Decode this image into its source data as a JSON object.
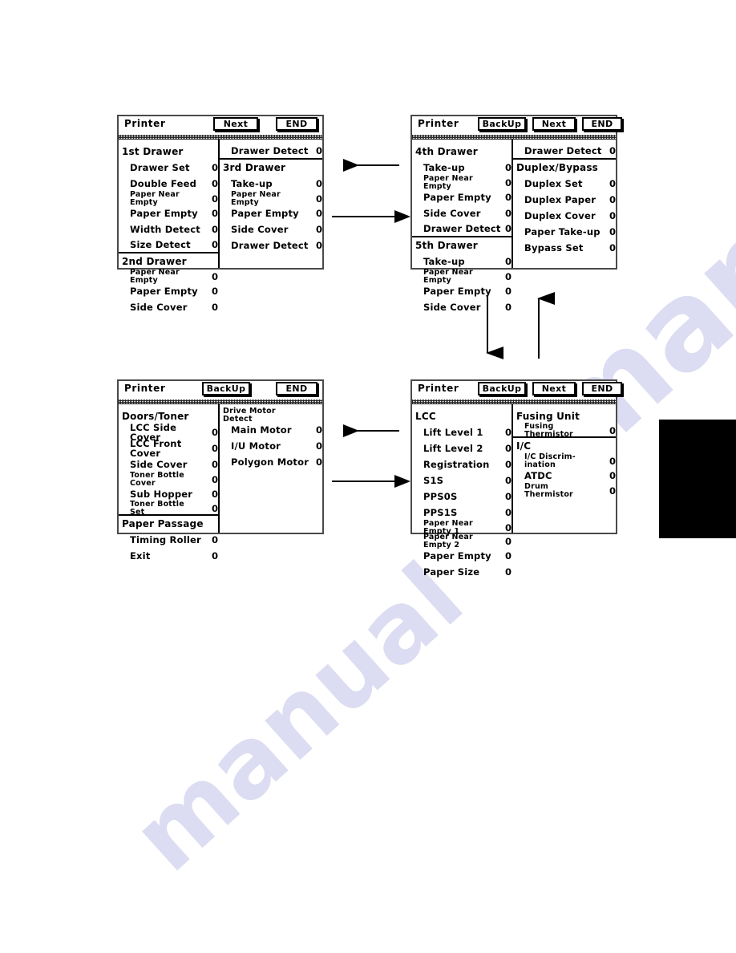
{
  "document": {
    "watermark": [
      "manual",
      "manual"
    ],
    "page_tab": "black-edge-tab"
  },
  "panels": [
    {
      "id": "panel-drawers-1",
      "title": "Printer",
      "buttons": [
        {
          "name": "next-button",
          "label": "Next"
        },
        {
          "name": "end-button",
          "label": "END"
        }
      ],
      "left_column": [
        {
          "type": "head",
          "label": "1st Drawer"
        },
        {
          "type": "item",
          "label": "Drawer Set",
          "value": "0"
        },
        {
          "type": "item",
          "label": "Double Feed",
          "value": "0"
        },
        {
          "type": "item2",
          "label": "Paper Near\nEmpty",
          "value": "0"
        },
        {
          "type": "item",
          "label": "Paper Empty",
          "value": "0"
        },
        {
          "type": "item",
          "label": "Width Detect",
          "value": "0"
        },
        {
          "type": "item",
          "label": "Size Detect",
          "value": "0",
          "rule": true
        },
        {
          "type": "head",
          "label": "2nd Drawer"
        },
        {
          "type": "item2",
          "label": "Paper Near\nEmpty",
          "value": "0"
        },
        {
          "type": "item",
          "label": "Paper Empty",
          "value": "0"
        },
        {
          "type": "item",
          "label": "Side Cover",
          "value": "0"
        }
      ],
      "right_column": [
        {
          "type": "item",
          "label": "Drawer Detect",
          "value": "0",
          "rule": true
        },
        {
          "type": "head",
          "label": "3rd Drawer"
        },
        {
          "type": "item",
          "label": "Take-up",
          "value": "0"
        },
        {
          "type": "item2",
          "label": "Paper Near\nEmpty",
          "value": "0"
        },
        {
          "type": "item",
          "label": "Paper Empty",
          "value": "0"
        },
        {
          "type": "item",
          "label": "Side Cover",
          "value": "0"
        },
        {
          "type": "item",
          "label": "Drawer Detect",
          "value": "0"
        }
      ]
    },
    {
      "id": "panel-drawers-2",
      "title": "Printer",
      "buttons": [
        {
          "name": "backup-button",
          "label": "BackUp"
        },
        {
          "name": "next-button",
          "label": "Next"
        },
        {
          "name": "end-button",
          "label": "END"
        }
      ],
      "left_column": [
        {
          "type": "head",
          "label": "4th Drawer"
        },
        {
          "type": "item",
          "label": "Take-up",
          "value": "0"
        },
        {
          "type": "item2",
          "label": "Paper Near\nEmpty",
          "value": "0"
        },
        {
          "type": "item",
          "label": "Paper Empty",
          "value": "0"
        },
        {
          "type": "item",
          "label": "Side Cover",
          "value": "0"
        },
        {
          "type": "item",
          "label": "Drawer Detect",
          "value": "0",
          "rule": true
        },
        {
          "type": "head",
          "label": "5th Drawer"
        },
        {
          "type": "item",
          "label": "Take-up",
          "value": "0"
        },
        {
          "type": "item2",
          "label": "Paper Near\nEmpty",
          "value": "0"
        },
        {
          "type": "item",
          "label": "Paper Empty",
          "value": "0"
        },
        {
          "type": "item",
          "label": "Side Cover",
          "value": "0"
        }
      ],
      "right_column": [
        {
          "type": "item",
          "label": "Drawer Detect",
          "value": "0",
          "rule": true
        },
        {
          "type": "head",
          "label": "Duplex/Bypass"
        },
        {
          "type": "item",
          "label": "Duplex Set",
          "value": "0"
        },
        {
          "type": "item",
          "label": "Duplex Paper",
          "value": "0"
        },
        {
          "type": "item",
          "label": "Duplex Cover",
          "value": "0"
        },
        {
          "type": "item",
          "label": "Paper Take-up",
          "value": "0"
        },
        {
          "type": "item",
          "label": "Bypass Set",
          "value": "0"
        }
      ]
    },
    {
      "id": "panel-doors-toner",
      "title": "Printer",
      "buttons": [
        {
          "name": "backup-button",
          "label": "BackUp"
        },
        {
          "name": "end-button",
          "label": "END"
        }
      ],
      "left_column": [
        {
          "type": "head",
          "label": "Doors/Toner"
        },
        {
          "type": "item",
          "label": "LCC Side Cover",
          "value": "0"
        },
        {
          "type": "item",
          "label": "LCC Front Cover",
          "value": "0"
        },
        {
          "type": "item",
          "label": "Side Cover",
          "value": "0"
        },
        {
          "type": "item2",
          "label": "Toner Bottle\nCover",
          "value": "0"
        },
        {
          "type": "item",
          "label": "Sub Hopper",
          "value": "0"
        },
        {
          "type": "item2",
          "label": "Toner Bottle\nSet",
          "value": "0",
          "rule": true
        },
        {
          "type": "head",
          "label": "Paper Passage"
        },
        {
          "type": "item",
          "label": "Timing Roller",
          "value": "0"
        },
        {
          "type": "item",
          "label": "Exit",
          "value": "0"
        }
      ],
      "right_column": [
        {
          "type": "head2",
          "label": "Drive Motor\nDetect"
        },
        {
          "type": "item",
          "label": "Main Motor",
          "value": "0"
        },
        {
          "type": "item",
          "label": "I/U Motor",
          "value": "0"
        },
        {
          "type": "item",
          "label": "Polygon Motor",
          "value": "0"
        }
      ]
    },
    {
      "id": "panel-lcc-fusing",
      "title": "Printer",
      "buttons": [
        {
          "name": "backup-button",
          "label": "BackUp"
        },
        {
          "name": "next-button",
          "label": "Next"
        },
        {
          "name": "end-button",
          "label": "END"
        }
      ],
      "left_column": [
        {
          "type": "head",
          "label": "LCC"
        },
        {
          "type": "item",
          "label": "Lift Level 1",
          "value": "0"
        },
        {
          "type": "item",
          "label": "Lift Level 2",
          "value": "0"
        },
        {
          "type": "item",
          "label": "Registration",
          "value": "0"
        },
        {
          "type": "item",
          "label": "S1S",
          "value": "0"
        },
        {
          "type": "item",
          "label": "PPS0S",
          "value": "0"
        },
        {
          "type": "item",
          "label": "PPS1S",
          "value": "0"
        },
        {
          "type": "item2",
          "label": "Paper Near\nEmpty 1",
          "value": "0"
        },
        {
          "type": "item2",
          "label": "Paper Near\nEmpty 2",
          "value": "0"
        },
        {
          "type": "item",
          "label": "Paper Empty",
          "value": "0"
        },
        {
          "type": "item",
          "label": "Paper Size",
          "value": "0"
        }
      ],
      "right_column": [
        {
          "type": "head",
          "label": "Fusing Unit"
        },
        {
          "type": "item2",
          "label": "Fusing\nThermistor",
          "value": "0",
          "rule": true
        },
        {
          "type": "head",
          "label": "I/C"
        },
        {
          "type": "item2",
          "label": "I/C Discrim-\nination",
          "value": "0"
        },
        {
          "type": "item",
          "label": "ATDC",
          "value": "0"
        },
        {
          "type": "item2",
          "label": "Drum\nThermistor",
          "value": "0"
        }
      ]
    }
  ],
  "arrows": [
    {
      "name": "arrow-left-top",
      "direction": "left"
    },
    {
      "name": "arrow-right-top",
      "direction": "right"
    },
    {
      "name": "arrow-down-right",
      "direction": "down"
    },
    {
      "name": "arrow-up-right",
      "direction": "up"
    },
    {
      "name": "arrow-left-bottom",
      "direction": "left"
    },
    {
      "name": "arrow-right-bottom",
      "direction": "right"
    }
  ]
}
